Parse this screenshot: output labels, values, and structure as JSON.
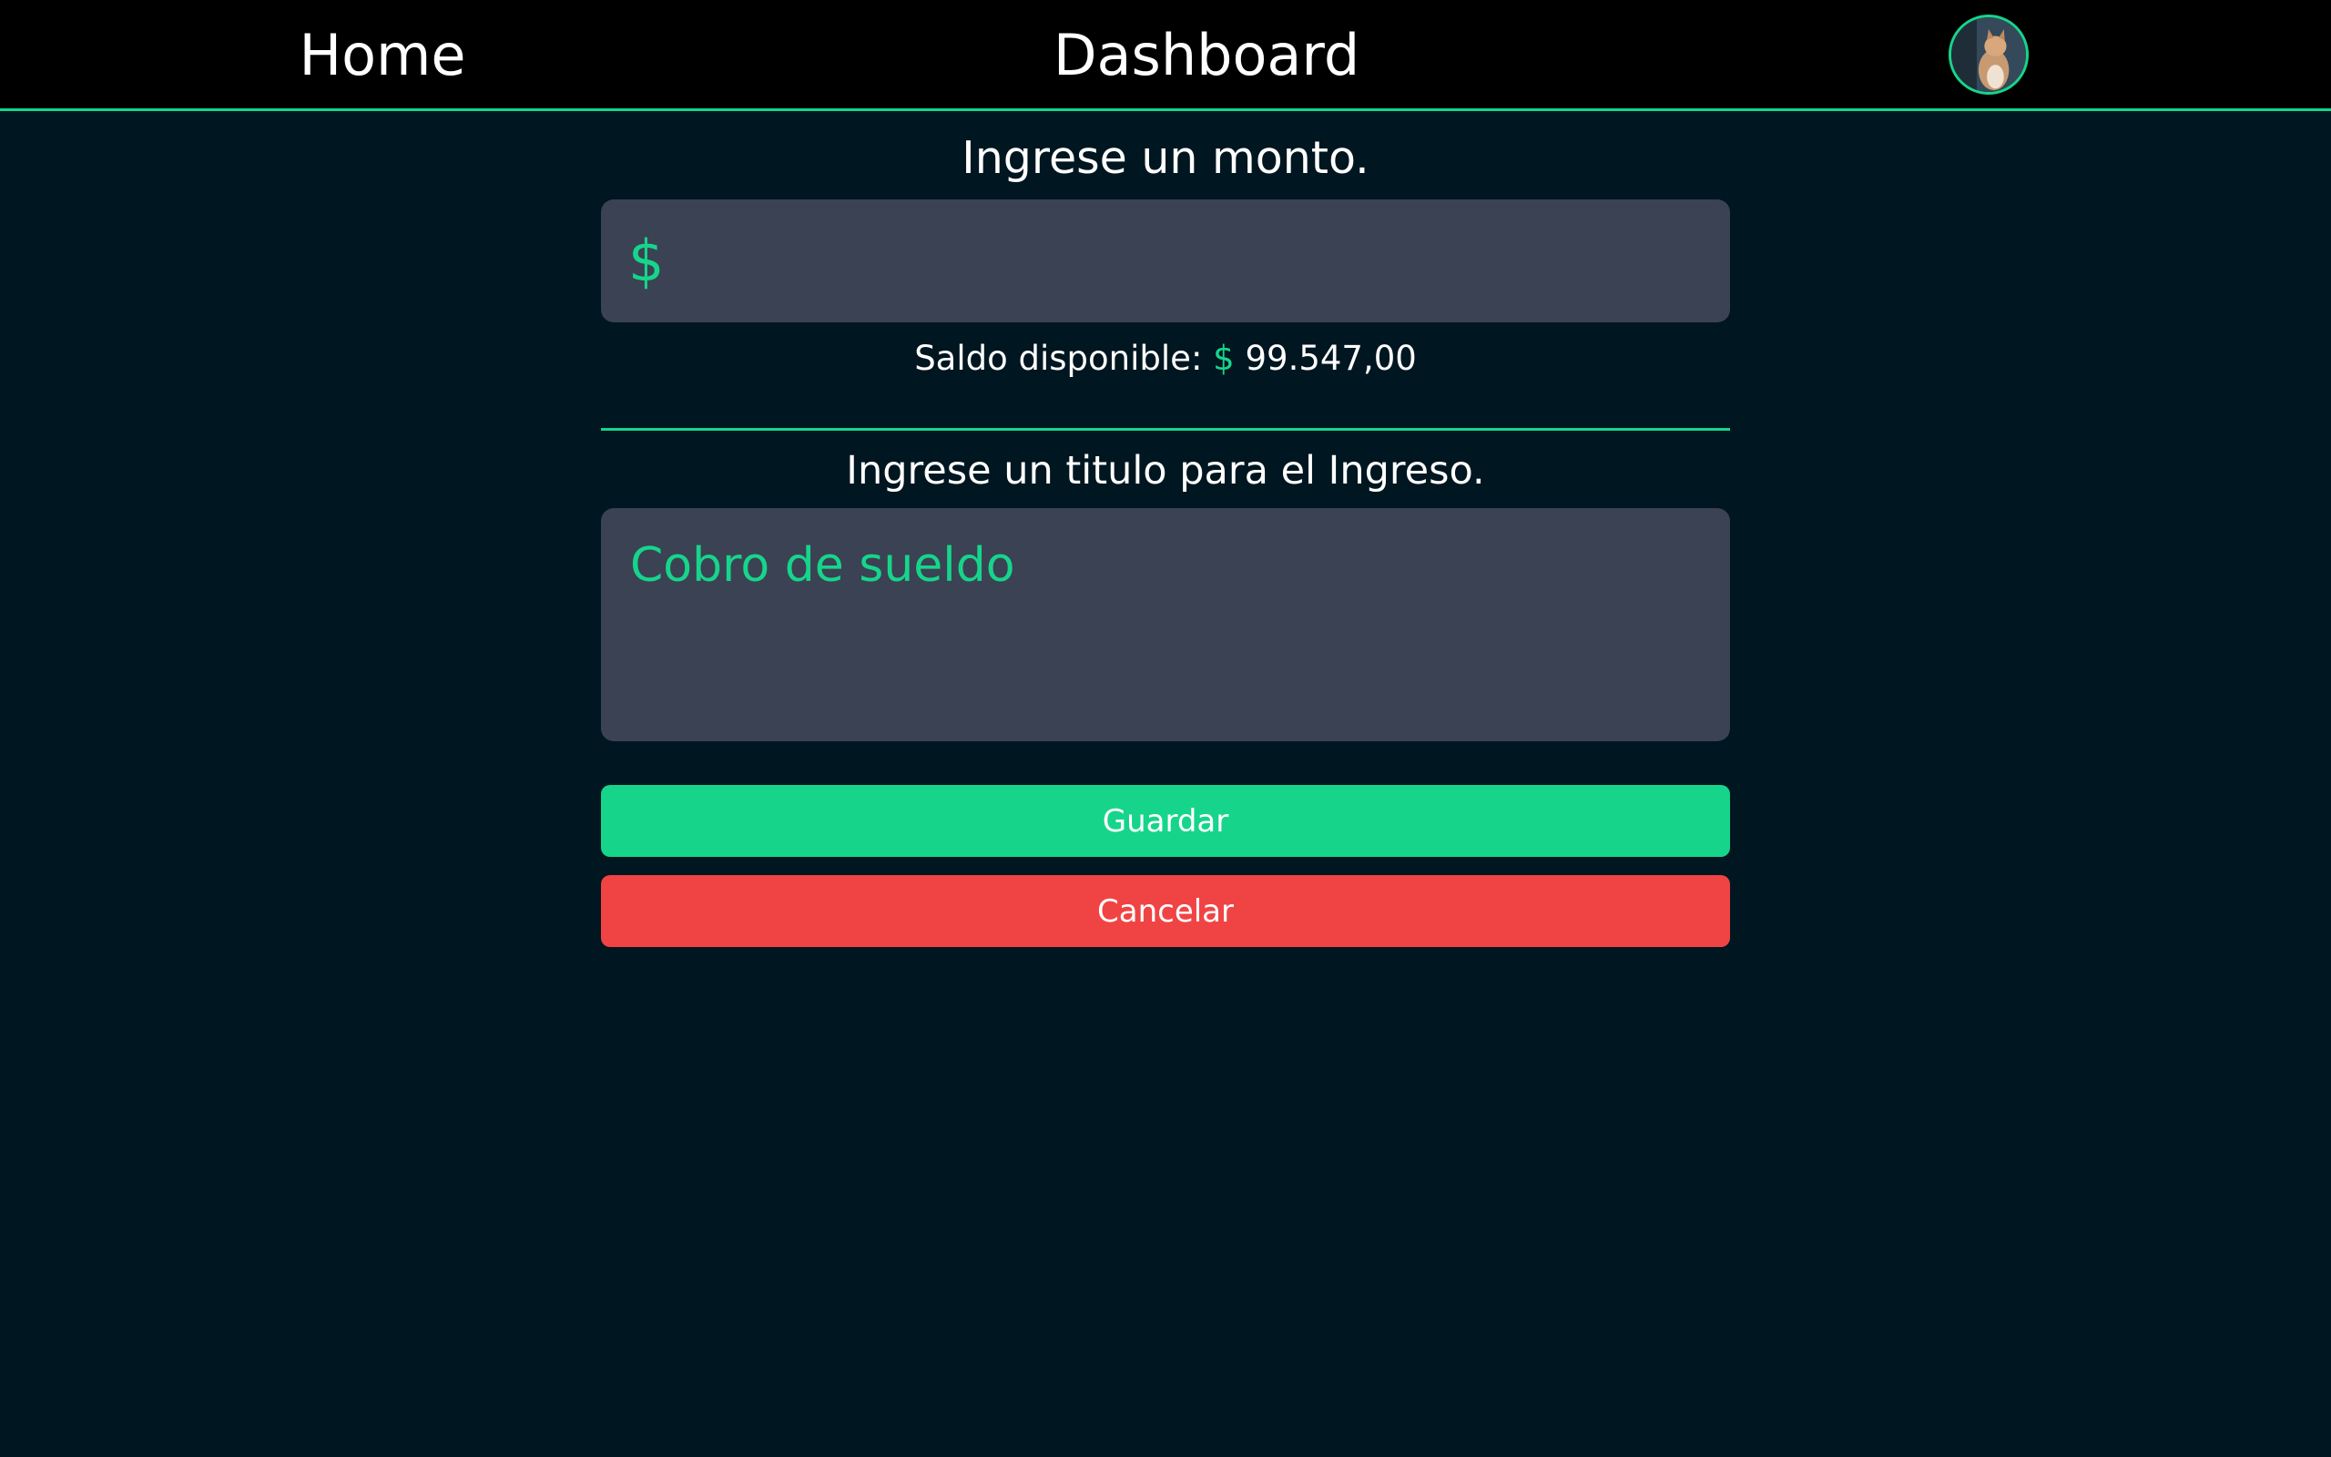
{
  "nav": {
    "home_label": "Home",
    "dashboard_label": "Dashboard"
  },
  "form": {
    "amount_heading": "Ingrese un monto.",
    "amount_prefix": "$",
    "amount_value": "",
    "balance_label": "Saldo disponible:",
    "balance_currency": "$",
    "balance_value": "99.547,00",
    "title_heading": "Ingrese un titulo para el Ingreso.",
    "title_value": "Cobro de sueldo"
  },
  "buttons": {
    "save_label": "Guardar",
    "cancel_label": "Cancelar"
  },
  "colors": {
    "accent": "#16d58b",
    "danger": "#f04444",
    "background": "#001620",
    "input_bg": "#3a4253"
  }
}
